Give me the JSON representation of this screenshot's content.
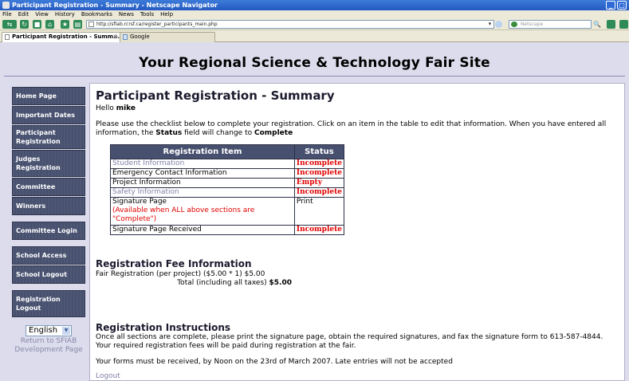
{
  "browser": {
    "window_title": "Participant Registration - Summary - Netscape Navigator",
    "menu": [
      "File",
      "Edit",
      "View",
      "History",
      "Bookmarks",
      "News",
      "Tools",
      "Help"
    ],
    "url": "http://sfiab.rcrsf.ca/register_participants_main.php",
    "search_placeholder": "Netscape",
    "tabs": [
      {
        "label": "Participant Registration - Summ...",
        "active": true
      },
      {
        "label": "Google",
        "active": false
      }
    ]
  },
  "site": {
    "title": "Your Regional Science & Technology Fair Site"
  },
  "sidebar": {
    "items": [
      {
        "label": "Home Page"
      },
      {
        "label": "Important Dates"
      },
      {
        "label": "Participant Registration"
      },
      {
        "label": "Judges Registration"
      },
      {
        "label": "Committee"
      },
      {
        "label": "Winners"
      },
      {
        "label": "Committee Login"
      },
      {
        "label": "School Access"
      },
      {
        "label": "School Logout"
      },
      {
        "label": "Registration Logout"
      }
    ],
    "language": "English",
    "return_link": "Return to SFIAB Development Page"
  },
  "main": {
    "heading": "Participant Registration - Summary",
    "greeting_prefix": "Hello ",
    "greeting_name": "mike",
    "instructions_part1": "Please use the checklist below to complete your registration. Click on an item in the table to edit that information. When you have entered all information, the ",
    "instructions_status_word": "Status",
    "instructions_part2": " field will change to ",
    "instructions_complete_word": "Complete",
    "table": {
      "headers": [
        "Registration Item",
        "Status"
      ],
      "rows": [
        {
          "item": "Student Information",
          "status": "Incomplete"
        },
        {
          "item": "Emergency Contact Information",
          "status": "Incomplete"
        },
        {
          "item": "Project Information",
          "status": "Empty"
        },
        {
          "item": "Safety Information",
          "status": "Incomplete"
        },
        {
          "item": "Signature Page",
          "note": "(Available when ALL above sections are \"Complete\")",
          "status": "Print"
        },
        {
          "item": "Signature Page Received",
          "status": "Incomplete"
        }
      ]
    },
    "fee": {
      "heading": "Registration Fee Information",
      "line1_label": "Fair Registration (per project) ($5.00 * 1) $5.00",
      "total_label": "Total (including all taxes) ",
      "total_value": "$5.00"
    },
    "reg_instructions": {
      "heading": "Registration Instructions",
      "text": "Once all sections are complete, please print the signature page, obtain the required signatures, and fax the signature form to 613-587-4844. Your required registration fees will be paid during registration at the fair.",
      "deadline": "Your forms must be received, by Noon on the 23rd of March 2007. Late entries will not be accepted"
    },
    "logout_label": "Logout"
  }
}
